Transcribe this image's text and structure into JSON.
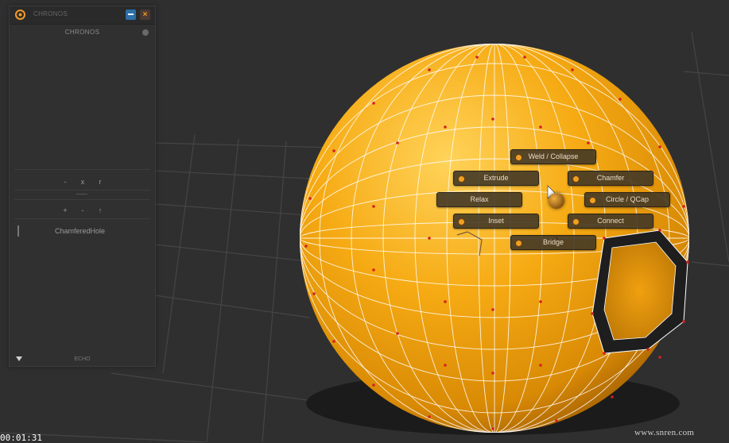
{
  "panel": {
    "window_title": "CHRONOS",
    "header_label": "CHRONOS",
    "controls_row1": [
      "-",
      "x",
      "r"
    ],
    "controls_row2": [
      "+",
      "-",
      "↑"
    ],
    "history_items": [
      "ChamferedHole"
    ],
    "footer_label": "ECHO"
  },
  "marking_menu": {
    "items": [
      {
        "id": "weld-collapse",
        "label": "Weld / Collapse"
      },
      {
        "id": "extrude",
        "label": "Extrude"
      },
      {
        "id": "chamfer",
        "label": "Chamfer"
      },
      {
        "id": "relax",
        "label": "Relax"
      },
      {
        "id": "circle-qcap",
        "label": "Circle / QCap"
      },
      {
        "id": "inset",
        "label": "Inset"
      },
      {
        "id": "connect",
        "label": "Connect"
      },
      {
        "id": "bridge",
        "label": "Bridge"
      }
    ]
  },
  "overlay": {
    "timestamp": "00:01:31",
    "watermark": "www.snren.com"
  },
  "colors": {
    "mesh": "#f5a80e",
    "wire": "#ffffff",
    "vertex": "#d42020",
    "accent": "#f39a2a"
  }
}
